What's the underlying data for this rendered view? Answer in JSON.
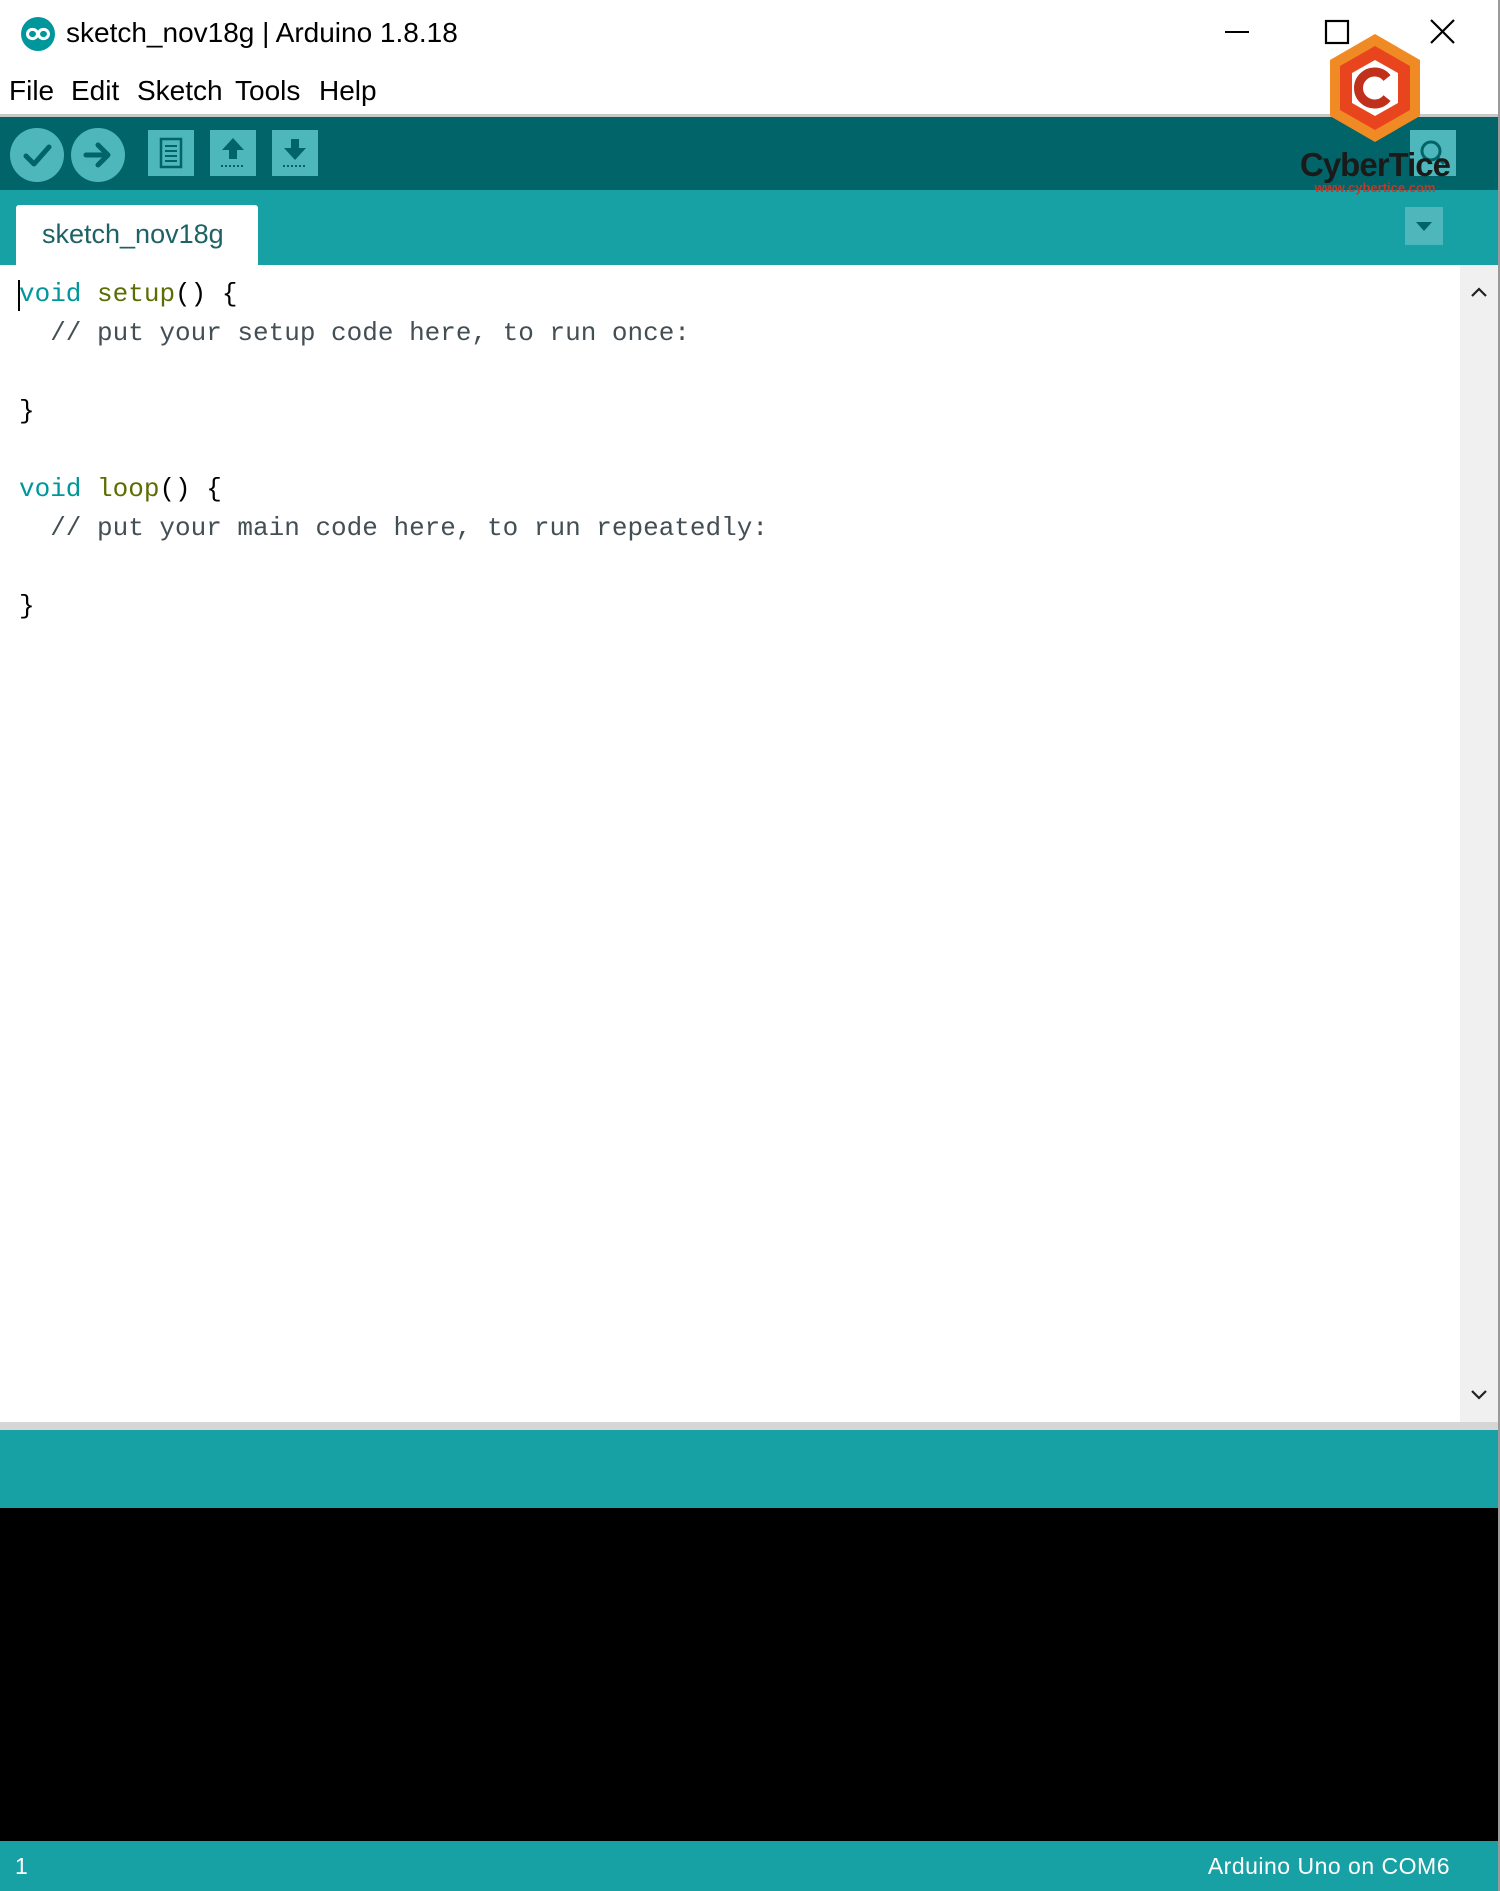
{
  "window": {
    "title": "sketch_nov18g | Arduino 1.8.18"
  },
  "menu": {
    "items": [
      "File",
      "Edit",
      "Sketch",
      "Tools",
      "Help"
    ]
  },
  "toolbar": {
    "buttons": [
      "verify-icon",
      "upload-icon",
      "new-icon",
      "open-icon",
      "save-icon",
      "serial-monitor-icon"
    ]
  },
  "tabs": [
    {
      "label": "sketch_nov18g"
    }
  ],
  "editor": {
    "lines": [
      [
        {
          "t": "void",
          "c": "kw"
        },
        {
          "t": " "
        },
        {
          "t": "setup",
          "c": "fn"
        },
        {
          "t": "() {"
        }
      ],
      [
        {
          "t": "  // put your setup code here, to run once:",
          "c": "cm"
        }
      ],
      [
        {
          "t": ""
        }
      ],
      [
        {
          "t": "}"
        }
      ],
      [
        {
          "t": ""
        }
      ],
      [
        {
          "t": "void",
          "c": "kw"
        },
        {
          "t": " "
        },
        {
          "t": "loop",
          "c": "fn"
        },
        {
          "t": "() {"
        }
      ],
      [
        {
          "t": "  // put your main code here, to run repeatedly:",
          "c": "cm"
        }
      ],
      [
        {
          "t": ""
        }
      ],
      [
        {
          "t": "}"
        }
      ]
    ]
  },
  "status": {
    "line_number": "1",
    "board_port": "Arduino Uno on COM6"
  },
  "watermark": {
    "brand": "CyberTice",
    "url": "www.cybertice.com"
  },
  "colors": {
    "toolbar": "#006468",
    "tabbar": "#17a1a5",
    "button": "#4db7bb",
    "keyword": "#00979c",
    "function": "#5e6d03",
    "comment": "#434f54"
  }
}
